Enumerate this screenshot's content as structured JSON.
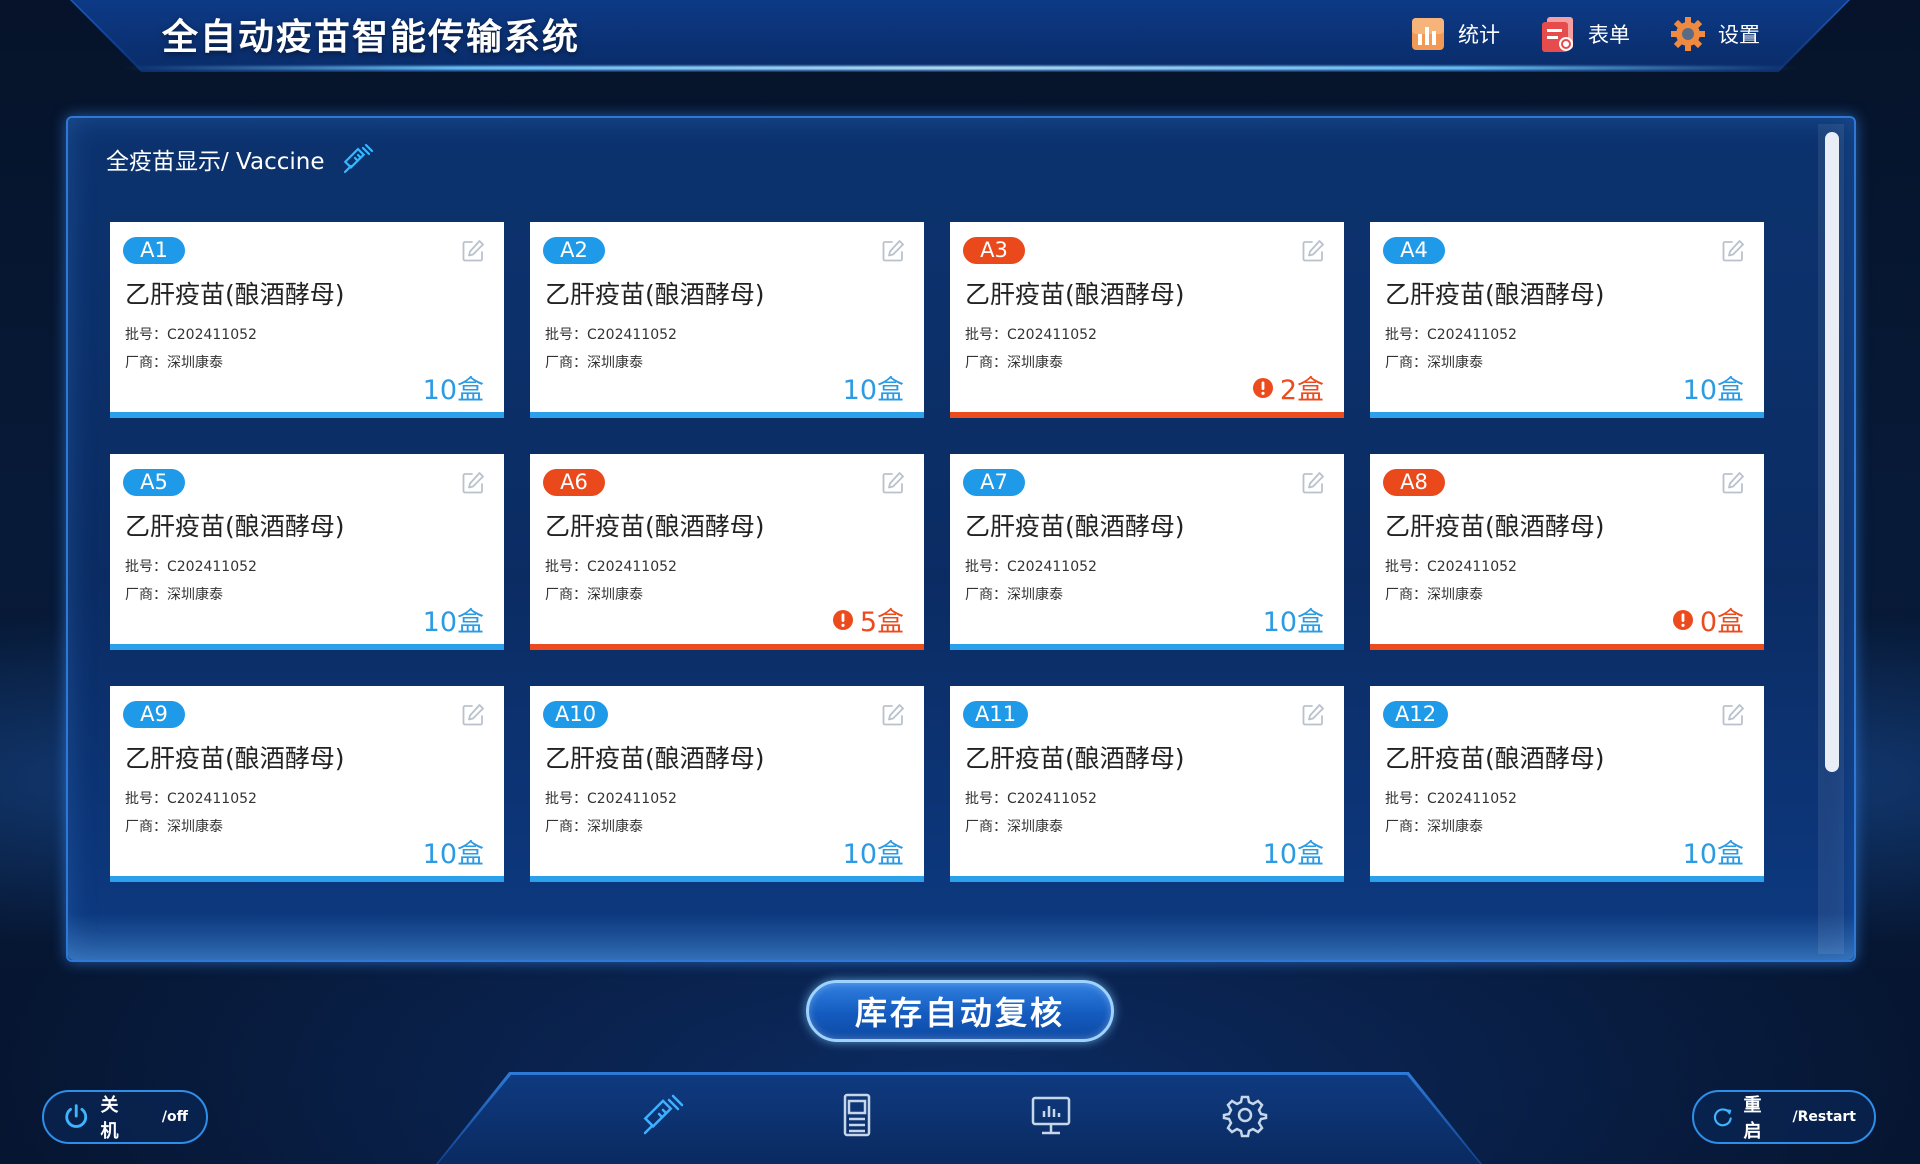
{
  "header": {
    "title": "全自动疫苗智能传输系统",
    "nav": [
      {
        "label": "统计",
        "icon": "bar-chart-icon"
      },
      {
        "label": "表单",
        "icon": "form-icon"
      },
      {
        "label": "设置",
        "icon": "gear-icon"
      }
    ]
  },
  "panel": {
    "title": "全疫苗显示/ Vaccine",
    "cards": [
      {
        "tag": "A1",
        "name": "乙肝疫苗(酿酒酵母)",
        "batch": "批号：C202411052",
        "maker": "厂商：深圳康泰",
        "qty": "10盒",
        "status": "normal"
      },
      {
        "tag": "A2",
        "name": "乙肝疫苗(酿酒酵母)",
        "batch": "批号：C202411052",
        "maker": "厂商：深圳康泰",
        "qty": "10盒",
        "status": "normal"
      },
      {
        "tag": "A3",
        "name": "乙肝疫苗(酿酒酵母)",
        "batch": "批号：C202411052",
        "maker": "厂商：深圳康泰",
        "qty": "2盒",
        "status": "warn"
      },
      {
        "tag": "A4",
        "name": "乙肝疫苗(酿酒酵母)",
        "batch": "批号：C202411052",
        "maker": "厂商：深圳康泰",
        "qty": "10盒",
        "status": "normal"
      },
      {
        "tag": "A5",
        "name": "乙肝疫苗(酿酒酵母)",
        "batch": "批号：C202411052",
        "maker": "厂商：深圳康泰",
        "qty": "10盒",
        "status": "normal"
      },
      {
        "tag": "A6",
        "name": "乙肝疫苗(酿酒酵母)",
        "batch": "批号：C202411052",
        "maker": "厂商：深圳康泰",
        "qty": "5盒",
        "status": "warn"
      },
      {
        "tag": "A7",
        "name": "乙肝疫苗(酿酒酵母)",
        "batch": "批号：C202411052",
        "maker": "厂商：深圳康泰",
        "qty": "10盒",
        "status": "normal"
      },
      {
        "tag": "A8",
        "name": "乙肝疫苗(酿酒酵母)",
        "batch": "批号：C202411052",
        "maker": "厂商：深圳康泰",
        "qty": "0盒",
        "status": "warn"
      },
      {
        "tag": "A9",
        "name": "乙肝疫苗(酿酒酵母)",
        "batch": "批号：C202411052",
        "maker": "厂商：深圳康泰",
        "qty": "10盒",
        "status": "normal"
      },
      {
        "tag": "A10",
        "name": "乙肝疫苗(酿酒酵母)",
        "batch": "批号：C202411052",
        "maker": "厂商：深圳康泰",
        "qty": "10盒",
        "status": "normal"
      },
      {
        "tag": "A11",
        "name": "乙肝疫苗(酿酒酵母)",
        "batch": "批号：C202411052",
        "maker": "厂商：深圳康泰",
        "qty": "10盒",
        "status": "normal"
      },
      {
        "tag": "A12",
        "name": "乙肝疫苗(酿酒酵母)",
        "batch": "批号：C202411052",
        "maker": "厂商：深圳康泰",
        "qty": "10盒",
        "status": "normal"
      }
    ]
  },
  "actions": {
    "primary": "库存自动复核",
    "power": {
      "main": "关 机",
      "sub": "/off"
    },
    "restart": {
      "main": "重 启",
      "sub": "/Restart"
    }
  },
  "dock": [
    "syringe-icon",
    "cabinet-icon",
    "monitor-icon",
    "gear-icon"
  ],
  "colors": {
    "accent": "#1f9ae8",
    "warn": "#ea4a1b",
    "card_bg": "#ffffff"
  }
}
